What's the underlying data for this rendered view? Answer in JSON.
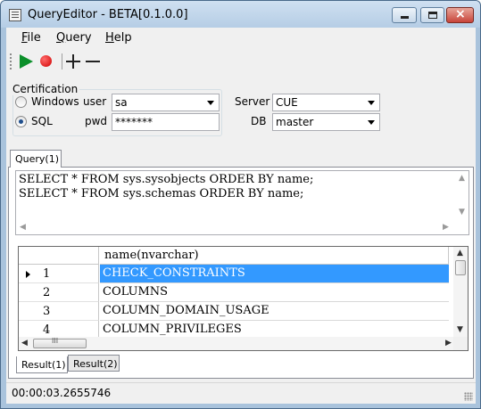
{
  "window": {
    "title": "QueryEditor - BETA[0.1.0.0]"
  },
  "menu": [
    {
      "label": "File",
      "mnemonic": "F",
      "rest": "ile"
    },
    {
      "label": "Query",
      "mnemonic": "Q",
      "rest": "uery"
    },
    {
      "label": "Help",
      "mnemonic": "H",
      "rest": "elp"
    }
  ],
  "toolbar": {
    "icons": [
      "play-icon",
      "record-icon",
      "plus-icon",
      "minus-icon"
    ],
    "colors": {
      "play": "#0b8f2a",
      "record": "#d00000"
    }
  },
  "certification": {
    "label": "Certification",
    "windows_label": "Windows",
    "sql_label": "SQL",
    "selected": "SQL",
    "user_label": "user",
    "user_value": "sa",
    "pwd_label": "pwd",
    "pwd_value": "*******",
    "server_label": "Server",
    "server_value": "CUE",
    "db_label": "DB",
    "db_value": "master"
  },
  "query_tab": {
    "label": "Query(1)"
  },
  "editor": {
    "lines": [
      "SELECT * FROM sys.sysobjects ORDER BY name;",
      "SELECT * FROM sys.schemas ORDER BY name;"
    ]
  },
  "grid": {
    "column_header": "name(nvarchar)",
    "rows": [
      {
        "num": "1",
        "value": "CHECK_CONSTRAINTS",
        "selected": true
      },
      {
        "num": "2",
        "value": "COLUMNS",
        "selected": false
      },
      {
        "num": "3",
        "value": "COLUMN_DOMAIN_USAGE",
        "selected": false
      },
      {
        "num": "4",
        "value": "COLUMN_PRIVILEGES",
        "selected": false
      }
    ],
    "selection_color": "#3399ff",
    "hscroll_thumb_label": "III"
  },
  "result_tabs": [
    {
      "label": "Result(1)",
      "active": true
    },
    {
      "label": "Result(2)",
      "active": false
    }
  ],
  "status": {
    "elapsed": "00:00:03.2655746"
  }
}
